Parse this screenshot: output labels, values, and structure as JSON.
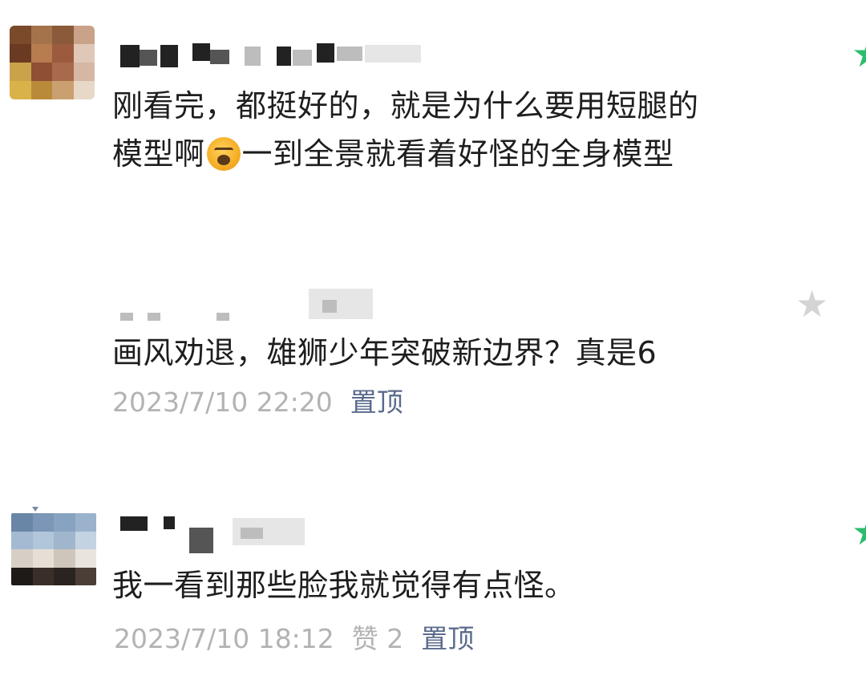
{
  "comments": [
    {
      "text_line1": "刚看完，都挺好的，就是为什么要用短腿的",
      "text_line2_before_emoji": "模型啊",
      "emoji": "sleepy-sigh-emoji",
      "text_line2_after_emoji": "一到全景就看着好怪的全身模型"
    },
    {
      "text": "画风劝退，雄狮少年突破新边界？真是6",
      "time": "2023/7/10 22:20",
      "pin_label": "置顶"
    },
    {
      "text": "我一看到那些脸我就觉得有点怪。",
      "time": "2023/7/10 18:12",
      "likes_label": "赞 2",
      "pin_label": "置顶"
    }
  ],
  "icons": {
    "star_outline": "★",
    "star_green": "★"
  },
  "colors": {
    "text": "#1e1e1e",
    "meta": "#b3b3b3",
    "pin_link": "#5a6b8c",
    "star_gray": "#d4d4d4",
    "star_green": "#2bbd6e"
  }
}
